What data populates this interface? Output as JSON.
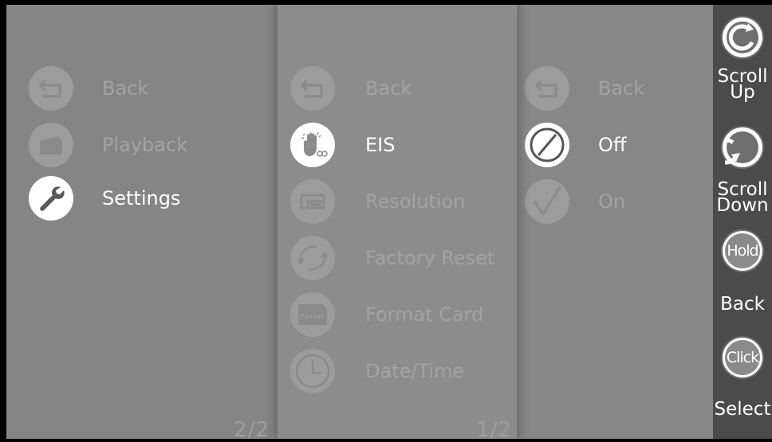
{
  "main_menu": {
    "items": [
      {
        "label": "Back",
        "icon": "back-arrow-icon",
        "selected": false
      },
      {
        "label": "Playback",
        "icon": "folder-icon",
        "selected": false
      },
      {
        "label": "Settings",
        "icon": "wrench-icon",
        "selected": true
      }
    ],
    "page_indicator": "2/2"
  },
  "settings_menu": {
    "items": [
      {
        "label": "Back",
        "icon": "back-arrow-icon",
        "selected": false
      },
      {
        "label": "EIS",
        "icon": "shaky-hand-icon",
        "selected": true
      },
      {
        "label": "Resolution",
        "icon": "resolution-icon",
        "selected": false
      },
      {
        "label": "Factory Reset",
        "icon": "refresh-icon",
        "selected": false
      },
      {
        "label": "Format Card",
        "icon": "sd-card-icon",
        "icon_text": "Format",
        "selected": false
      },
      {
        "label": "Date/Time",
        "icon": "clock-icon",
        "selected": false
      }
    ],
    "page_indicator": "1/2"
  },
  "eis_menu": {
    "items": [
      {
        "label": "Back",
        "icon": "back-arrow-icon",
        "selected": false
      },
      {
        "label": "Off",
        "icon": "disabled-icon",
        "selected": true
      },
      {
        "label": "On",
        "icon": "checkmark-icon",
        "selected": false
      }
    ]
  },
  "controls": {
    "scroll_up": {
      "label_line1": "Scroll",
      "label_line2": "Up"
    },
    "scroll_down": {
      "label_line1": "Scroll",
      "label_line2": "Down"
    },
    "back": {
      "button_text": "Hold",
      "label": "Back"
    },
    "select": {
      "button_text": "Click",
      "label": "Select"
    }
  },
  "colors": {
    "panel_main": "#858585",
    "panel_settings": "#8c8c8c",
    "panel_eis": "#878787",
    "control_bar": "#4b4b4b",
    "selected_text": "#ffffff",
    "dim_text": "#a3a3a3"
  }
}
